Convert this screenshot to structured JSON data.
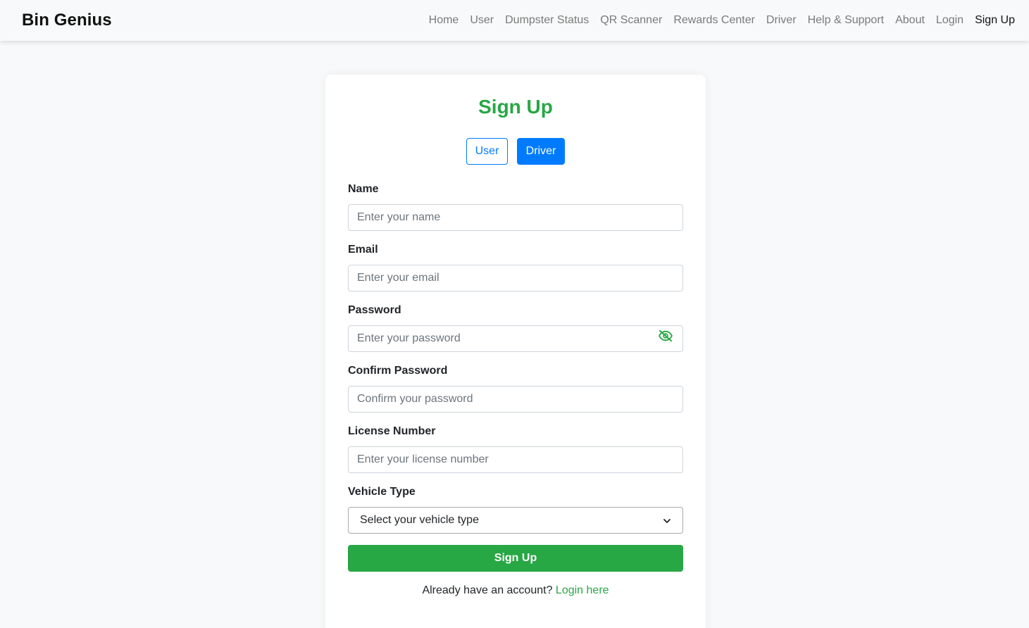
{
  "navbar": {
    "brand": "Bin Genius",
    "links": [
      {
        "label": "Home"
      },
      {
        "label": "User"
      },
      {
        "label": "Dumpster Status"
      },
      {
        "label": "QR Scanner"
      },
      {
        "label": "Rewards Center"
      },
      {
        "label": "Driver"
      },
      {
        "label": "Help & Support"
      },
      {
        "label": "About"
      },
      {
        "label": "Login"
      },
      {
        "label": "Sign Up"
      }
    ]
  },
  "form": {
    "title": "Sign Up",
    "toggle": {
      "user_label": "User",
      "driver_label": "Driver",
      "selected": "Driver"
    },
    "fields": {
      "name": {
        "label": "Name",
        "placeholder": "Enter your name"
      },
      "email": {
        "label": "Email",
        "placeholder": "Enter your email"
      },
      "password": {
        "label": "Password",
        "placeholder": "Enter your password"
      },
      "confirm_password": {
        "label": "Confirm Password",
        "placeholder": "Confirm your password"
      },
      "license": {
        "label": "License Number",
        "placeholder": "Enter your license number"
      },
      "vehicle": {
        "label": "Vehicle Type",
        "selected": "Select your vehicle type"
      }
    },
    "submit_label": "Sign Up",
    "footer_text": "Already have an account?",
    "footer_link": "Login here"
  },
  "icons": {
    "password_toggle": "eye-slash-icon",
    "select_arrow": "chevron-down-icon"
  },
  "colors": {
    "accent_green": "#28a745",
    "primary_blue": "#007bff",
    "background": "#f8f9fa"
  }
}
